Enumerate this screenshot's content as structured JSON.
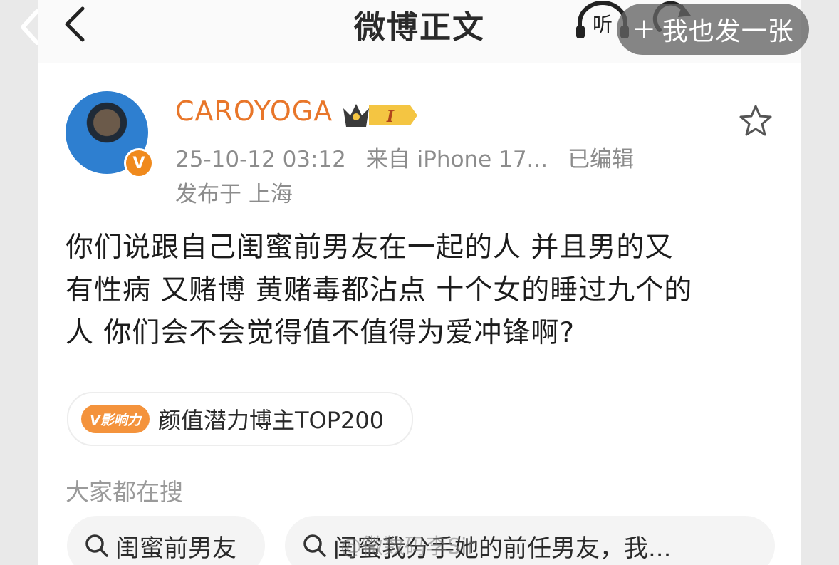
{
  "app": {
    "nav_title": "微博正文",
    "listen_label": "听",
    "share_pill_label": "我也发一张"
  },
  "post": {
    "username": "CAROYOGA",
    "vip_level": "I",
    "timestamp": "25-10-12 03:12",
    "source": "来自 iPhone 17...",
    "edited": "已编辑",
    "location": "发布于 上海",
    "body": "你们说跟自己闺蜜前男友在一起的人 并且男的又\n有性病 又赌博 黄赌毒都沾点 十个女的睡过九个的\n人 你们会不会觉得值不值得为爱冲锋啊?",
    "influence_icon_label": "V影响力",
    "influence_label": "颜值潜力博主TOP200"
  },
  "search": {
    "heading": "大家都在搜",
    "chips": [
      {
        "label": "闺蜜前男友"
      },
      {
        "label": "闺蜜我分手她的前任男友，我..."
      }
    ]
  },
  "watermark": "@微数码李Sir",
  "colors": {
    "username": "#e8762a",
    "verified": "#f08a1d",
    "influence": "#f4933c",
    "meta_text": "#8c8c8c"
  },
  "icons": [
    "back-arrow-icon",
    "headphones-icon",
    "refresh-icon",
    "more-icon",
    "plus-icon",
    "crown-icon",
    "star-icon",
    "verified-v-icon",
    "search-icon"
  ]
}
